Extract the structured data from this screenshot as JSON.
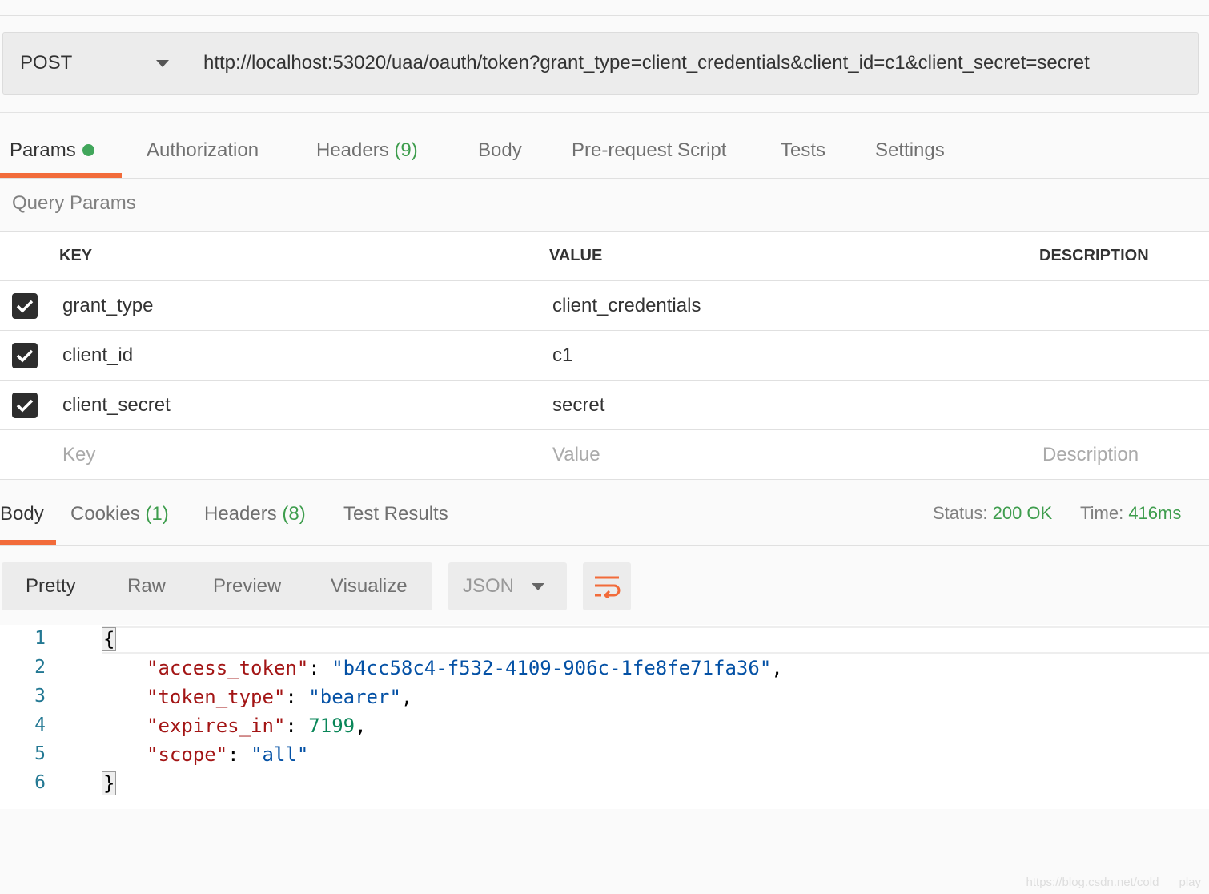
{
  "request": {
    "method": "POST",
    "url": "http://localhost:53020/uaa/oauth/token?grant_type=client_credentials&client_id=c1&client_secret=secret"
  },
  "request_tabs": {
    "params": "Params",
    "authorization": "Authorization",
    "headers": "Headers",
    "headers_count": "(9)",
    "body": "Body",
    "prerequest": "Pre-request Script",
    "tests": "Tests",
    "settings": "Settings"
  },
  "query_params": {
    "title": "Query Params",
    "columns": [
      "KEY",
      "VALUE",
      "DESCRIPTION"
    ],
    "rows": [
      {
        "checked": true,
        "key": "grant_type",
        "value": "client_credentials",
        "description": ""
      },
      {
        "checked": true,
        "key": "client_id",
        "value": "c1",
        "description": ""
      },
      {
        "checked": true,
        "key": "client_secret",
        "value": "secret",
        "description": ""
      }
    ],
    "placeholders": {
      "key": "Key",
      "value": "Value",
      "description": "Description"
    }
  },
  "response_tabs": {
    "body": "Body",
    "cookies": "Cookies",
    "cookies_count": "(1)",
    "headers": "Headers",
    "headers_count": "(8)",
    "test_results": "Test Results"
  },
  "response_status": {
    "status_label": "Status:",
    "status_value": "200 OK",
    "time_label": "Time:",
    "time_value": "416ms"
  },
  "view_modes": [
    "Pretty",
    "Raw",
    "Preview",
    "Visualize"
  ],
  "format": "JSON",
  "response_body": {
    "line_numbers": [
      "1",
      "2",
      "3",
      "4",
      "5",
      "6"
    ],
    "open_brace": "{",
    "close_brace": "}",
    "fields": [
      {
        "key": "\"access_token\"",
        "value": "\"b4cc58c4-f532-4109-906c-1fe8fe71fa36\"",
        "trail": ","
      },
      {
        "key": "\"token_type\"",
        "value": "\"bearer\"",
        "trail": ","
      },
      {
        "key": "\"expires_in\"",
        "value": "7199",
        "trail": ","
      },
      {
        "key": "\"scope\"",
        "value": "\"all\"",
        "trail": ""
      }
    ]
  },
  "watermark": "https://blog.csdn.net/cold___play",
  "colors": {
    "accent": "#f26b3a",
    "success": "#3e9d4d",
    "json_key": "#a31515",
    "json_string": "#0451a5",
    "json_number": "#098658"
  }
}
